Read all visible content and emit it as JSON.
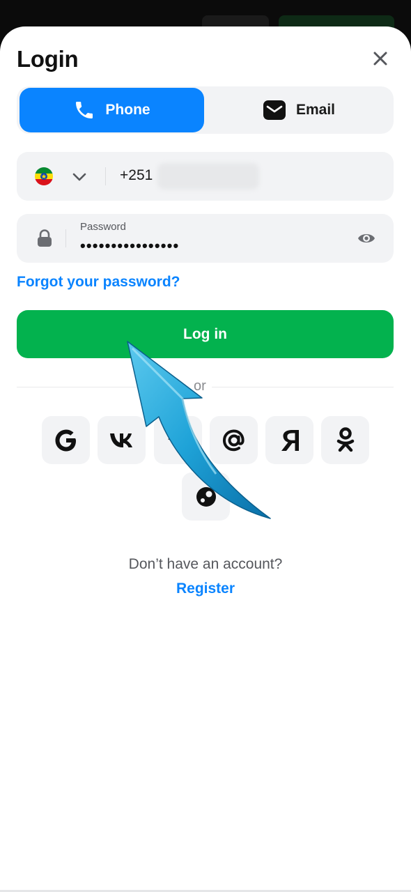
{
  "modal": {
    "title": "Login"
  },
  "tabs": [
    {
      "label": "Phone",
      "icon": "phone-icon",
      "active": true
    },
    {
      "label": "Email",
      "icon": "email-icon",
      "active": false
    }
  ],
  "phone": {
    "country_icon": "ethiopia-flag-icon",
    "prefix": "+251",
    "number": ""
  },
  "password": {
    "label": "Password",
    "value": "••••••••••••••••"
  },
  "links": {
    "forgot": "Forgot your password?",
    "no_account": "Don’t have an account?",
    "register": "Register"
  },
  "login_button": "Log in",
  "divider": "or",
  "social": [
    {
      "name": "google",
      "icon": "google-icon"
    },
    {
      "name": "vk",
      "icon": "vk-icon"
    },
    {
      "name": "telegram",
      "icon": "telegram-icon"
    },
    {
      "name": "mail",
      "icon": "at-sign-icon"
    },
    {
      "name": "yandex",
      "icon": "yandex-icon"
    },
    {
      "name": "odnoklassniki",
      "icon": "ok-icon"
    },
    {
      "name": "steam",
      "icon": "steam-icon"
    }
  ],
  "colors": {
    "accent_blue": "#0a84ff",
    "login_green": "#03b24e",
    "field_bg": "#f2f3f5",
    "arrow_blue": "#1fa3d8"
  }
}
